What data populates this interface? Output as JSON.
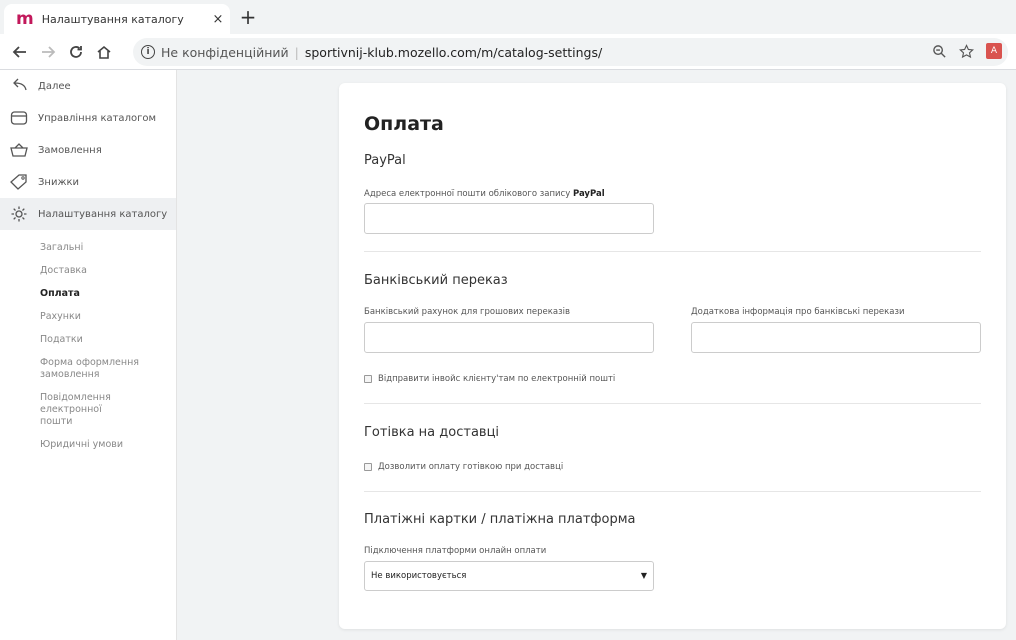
{
  "browser": {
    "tab_title": "Налаштування каталогу",
    "tab_close": "×",
    "new_tab": "+",
    "security_label": "Не конфіденційний",
    "url": "sportivnij-klub.mozello.com/m/catalog-settings/"
  },
  "sidebar": {
    "items": [
      {
        "label": "Далее",
        "icon": "back-arrow-icon"
      },
      {
        "label": "Управління каталогом",
        "icon": "box-icon"
      },
      {
        "label": "Замовлення",
        "icon": "basket-icon"
      },
      {
        "label": "Знижки",
        "icon": "tag-icon"
      },
      {
        "label": "Налаштування каталогу",
        "icon": "gear-icon"
      }
    ],
    "sub_items": [
      {
        "label": "Загальні"
      },
      {
        "label": "Доставка"
      },
      {
        "label": "Оплата"
      },
      {
        "label": "Рахунки"
      },
      {
        "label": "Податки"
      },
      {
        "label": "Форма оформлення замовлення"
      },
      {
        "label": "Повідомлення електронної пошти"
      },
      {
        "label": "Юридичні умови"
      }
    ]
  },
  "main": {
    "title": "Оплата",
    "paypal": {
      "heading": "PayPal",
      "email_label": "Адреса електронної пошти облікового запису",
      "email_label_bold": "PayPal",
      "email_value": ""
    },
    "bank": {
      "heading": "Банківський переказ",
      "account_label": "Банківський рахунок для грошових переказів",
      "info_label": "Додаткова інформація про банківські перекази",
      "send_invoice_label": "Відправити інвойс клієнту'там по електронній пошті"
    },
    "cash": {
      "heading": "Готівка на доставці",
      "allow_label": "Дозволити оплату готівкою при доставці"
    },
    "cards": {
      "heading": "Платіжні картки / платіжна платформа",
      "platform_label": "Підключення платформи онлайн оплати",
      "platform_value": "Не використовується",
      "dropdown_arrow": "▼"
    }
  }
}
